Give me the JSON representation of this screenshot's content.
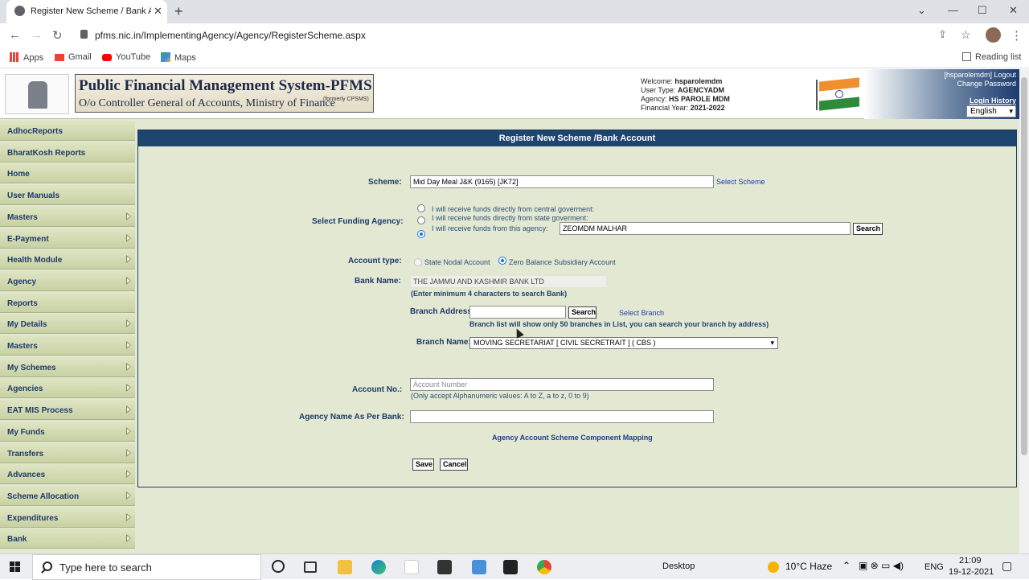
{
  "browser": {
    "tab_title": "Register New Scheme / Bank Ac",
    "url": "pfms.nic.in/ImplementingAgency/Agency/RegisterScheme.aspx",
    "bookmarks": [
      "Apps",
      "Gmail",
      "YouTube",
      "Maps"
    ],
    "reading_list": "Reading list"
  },
  "header": {
    "brand_title": "Public Financial Management System-PFMS",
    "brand_subtitle": "O/o Controller General of Accounts, Ministry of Finance",
    "brand_formerly": "(formerly CPSMS)",
    "welcome_label": "Welcome:",
    "welcome_value": "hsparolemdm",
    "usertype_label": "User Type:",
    "usertype_value": "AGENCYADM",
    "agency_label": "Agency:",
    "agency_value": "HS PAROLE MDM",
    "fy_label": "Financial Year:",
    "fy_value": "2021-2022",
    "user_link": "[hsparolemdm]",
    "logout": "Logout",
    "change_password": "Change Password",
    "login_history": "Login History",
    "language": "English"
  },
  "sidebar": {
    "items": [
      {
        "label": "AdhocReports",
        "arrow": false
      },
      {
        "label": "BharatKosh Reports",
        "arrow": false
      },
      {
        "label": "Home",
        "arrow": false
      },
      {
        "label": "User Manuals",
        "arrow": false
      },
      {
        "label": "Masters",
        "arrow": true
      },
      {
        "label": "E-Payment",
        "arrow": true
      },
      {
        "label": "Health Module",
        "arrow": true
      },
      {
        "label": "Agency",
        "arrow": true
      },
      {
        "label": "Reports",
        "arrow": false
      },
      {
        "label": "My Details",
        "arrow": true
      },
      {
        "label": "Masters",
        "arrow": true
      },
      {
        "label": "My Schemes",
        "arrow": true
      },
      {
        "label": "Agencies",
        "arrow": true
      },
      {
        "label": "EAT MIS Process",
        "arrow": true
      },
      {
        "label": "My Funds",
        "arrow": true
      },
      {
        "label": "Transfers",
        "arrow": true
      },
      {
        "label": "Advances",
        "arrow": true
      },
      {
        "label": "Scheme Allocation",
        "arrow": true
      },
      {
        "label": "Expenditures",
        "arrow": true
      },
      {
        "label": "Bank",
        "arrow": true
      }
    ]
  },
  "form": {
    "title": "Register New Scheme /Bank Account",
    "scheme_label": "Scheme:",
    "scheme_value": "Mid Day Meal J&K (9165) [JK72]",
    "select_scheme": "Select Scheme",
    "funding_label": "Select Funding Agency:",
    "funding_opt1": "I will receive funds directly from central goverment:",
    "funding_opt2": "I will receive funds directly from state goverment:",
    "funding_opt3": "I will receive funds from this agency:",
    "funding_agency_value": "ZEOMDM MALHAR",
    "search": "Search",
    "account_type_label": "Account type:",
    "acct_opt1": "State Nodal Account",
    "acct_opt2": "Zero Balance Subsidiary Account",
    "bank_name_label": "Bank Name:",
    "bank_name_value": "THE JAMMU AND KASHMIR BANK LTD",
    "bank_hint": "(Enter minimum 4 characters to search Bank)",
    "branch_address_label": "Branch Address:",
    "branch_address_value": "",
    "select_branch": "Select Branch",
    "branch_hint": "Branch list will show only 50 branches in List, you can search your branch by address)",
    "branch_name_label": "Branch Name:",
    "branch_name_value": "MOVING SECRETARIAT [ CIVIL SECRETRAIT ] ( CBS )",
    "account_no_label": "Account No.:",
    "account_no_placeholder": "Account Number",
    "account_no_hint": "(Only accept Alphanumeric values: A to Z, a to z, 0 to 9)",
    "agency_name_label": "Agency Name As Per Bank:",
    "agency_name_value": "",
    "mapping_link": "Agency Account Scheme Component Mapping",
    "save": "Save",
    "cancel": "Cancel"
  },
  "taskbar": {
    "search_placeholder": "Type here to search",
    "desktop": "Desktop",
    "weather": "10°C Haze",
    "lang": "ENG",
    "time": "21:09",
    "date": "19-12-2021"
  }
}
